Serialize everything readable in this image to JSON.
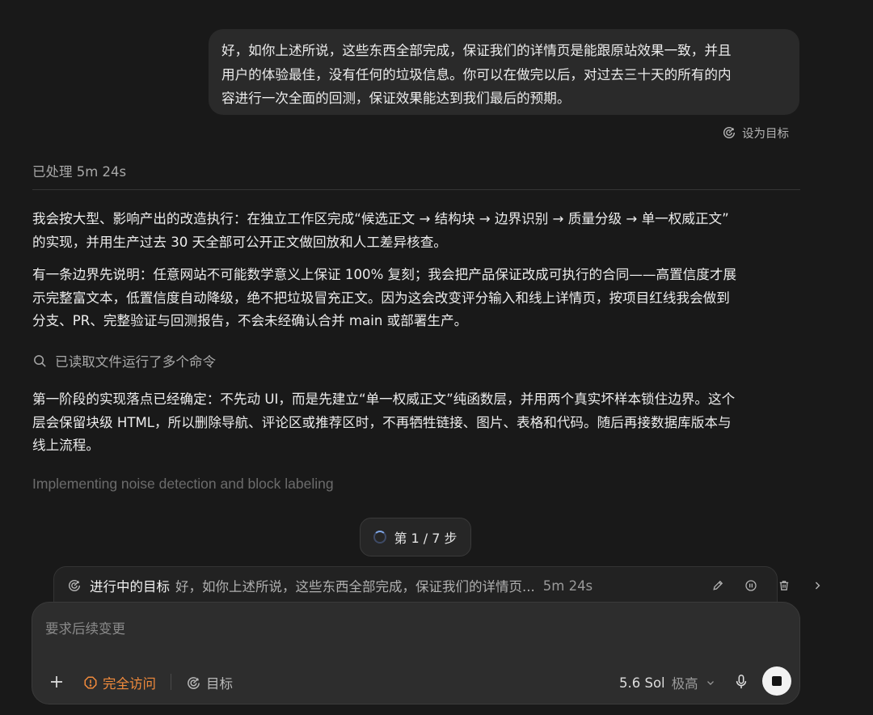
{
  "user_message": {
    "lines": [
      "好，如你上述所说，这些东西全部完成，保证我们的详情页是能跟原站效果一致，并且",
      "用户的体验最佳，没有任何的垃圾信息。你可以在做完以后，对过去三十天的所有的内",
      "容进行一次全面的回测，保证效果能达到我们最后的预期。"
    ],
    "set_goal_label": "设为目标"
  },
  "processed": "已处理 5m 24s",
  "assistant": {
    "para1": [
      "我会按大型、影响产出的改造执行：在独立工作区完成“候选正文 → 结构块 → 边界识别 → 质量分级 → 单一权威正文”",
      "的实现，并用生产过去 30 天全部可公开正文做回放和人工差异核查。"
    ],
    "para2": [
      "有一条边界先说明：任意网站不可能数学意义上保证 100% 复刻；我会把产品保证改成可执行的合同——高置信度才展",
      "示完整富文本，低置信度自动降级，绝不把垃圾冒充正文。因为这会改变评分输入和线上详情页，按项目红线我会做到",
      "分支、PR、完整验证与回测报告，不会未经确认合并 main 或部署生产。"
    ],
    "tool_summary": "已读取文件运行了多个命令",
    "para3": [
      "第一阶段的实现落点已经确定：不先动 UI，而是先建立“单一权威正文”纯函数层，并用两个真实坏样本锁住边界。这个",
      "层会保留块级 HTML，所以删除导航、评论区或推荐区时，不再牺牲链接、图片、表格和代码。随后再接数据库版本与",
      "线上流程。"
    ],
    "thinking": "Implementing noise detection and block labeling"
  },
  "step": "第 1 / 7 步",
  "goal_bar": {
    "label": "进行中的目标",
    "text": "好，如你上述所说，这些东西全部完成，保证我们的详情页...",
    "time": "5m 24s"
  },
  "composer": {
    "placeholder": "要求后续变更",
    "access_label": "完全访问",
    "goal_label": "目标",
    "model": "5.6 Sol",
    "level": "极高"
  },
  "colors": {
    "background": "#191919",
    "bubble": "#2a2a2a",
    "composer": "#2d2d2d",
    "access_orange": "#f08a3c",
    "spinner_blue": "#7fa6e6"
  },
  "icons": [
    "target-icon",
    "search-icon",
    "pencil-icon",
    "pause-icon",
    "trash-icon",
    "chevron-right-icon",
    "plus-icon",
    "warning-icon",
    "chevron-down-icon",
    "microphone-icon",
    "stop-icon"
  ]
}
